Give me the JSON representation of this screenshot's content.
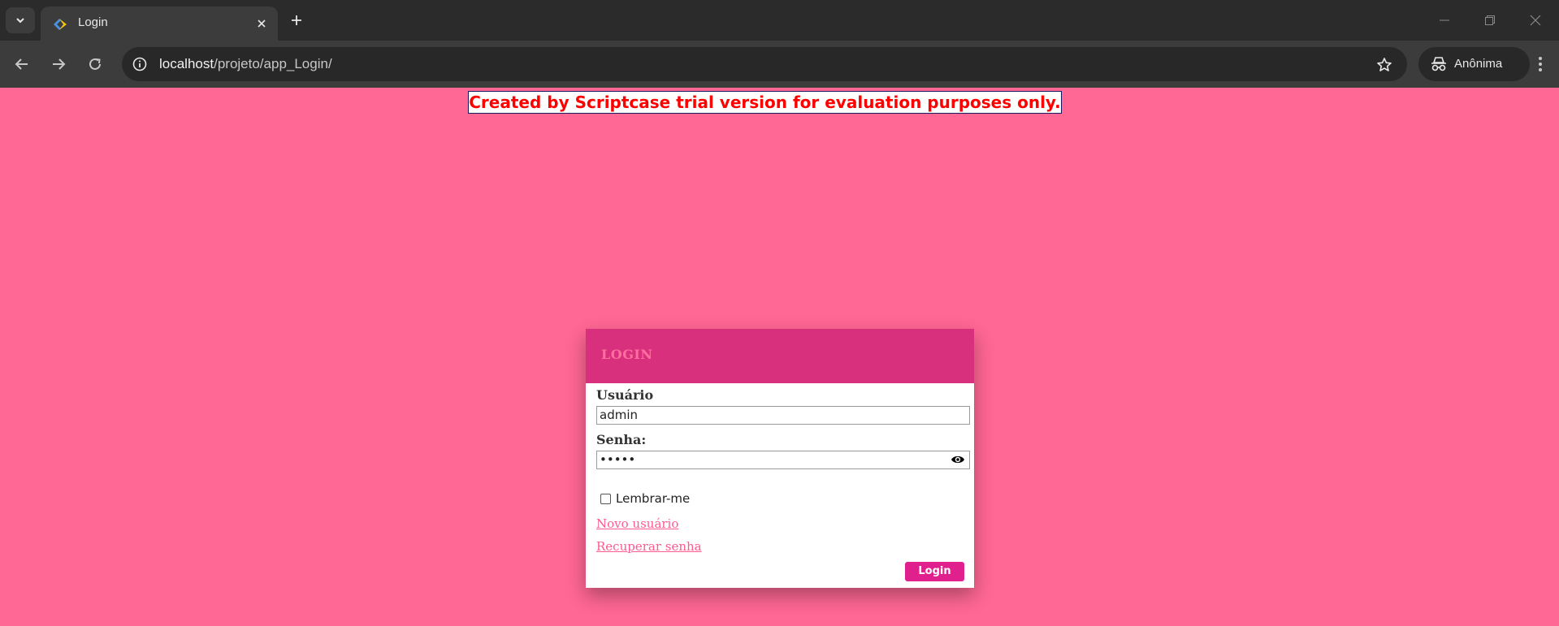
{
  "browser": {
    "tab_title": "Login",
    "url_host": "localhost",
    "url_path": "/projeto/app_Login/",
    "profile_label": "Anônima",
    "theme_color": "#3c3c3c"
  },
  "banner": {
    "text": "Created by Scriptcase trial version for evaluation purposes only.",
    "text_color": "#ff0000"
  },
  "login": {
    "title": "LOGIN",
    "username_label": "Usuário",
    "username_value": "admin",
    "password_label": "Senha:",
    "password_value": "•••••",
    "remember_label": "Lembrar-me",
    "remember_checked": false,
    "new_user_link": "Novo usuário",
    "recover_link": "Recuperar senha",
    "submit_label": "Login",
    "header_color": "#d9307d",
    "page_bg_color": "#ff6794"
  },
  "icons": [
    "tab-search-icon",
    "favicon-icon",
    "close-icon",
    "plus-icon",
    "minimize-icon",
    "restore-icon",
    "window-close-icon",
    "back-icon",
    "forward-icon",
    "reload-icon",
    "info-icon",
    "star-icon",
    "incognito-icon",
    "menu-icon",
    "eye-icon"
  ]
}
